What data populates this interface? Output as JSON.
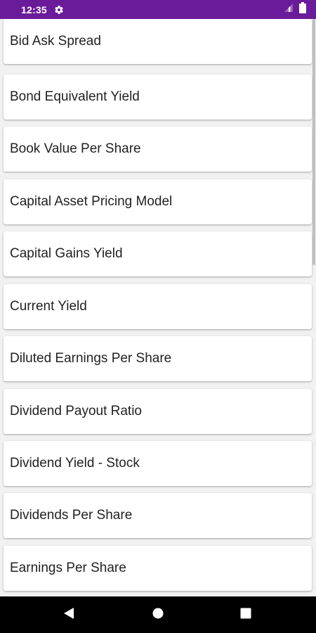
{
  "status_bar": {
    "time": "12:35",
    "icons": [
      "gear-icon",
      "signal-icon",
      "battery-icon"
    ],
    "background": "#6a1b9a"
  },
  "list": {
    "items": [
      {
        "label": "Bid Ask Spread"
      },
      {
        "label": "Bond Equivalent Yield"
      },
      {
        "label": "Book Value Per Share"
      },
      {
        "label": "Capital Asset Pricing Model"
      },
      {
        "label": "Capital Gains Yield"
      },
      {
        "label": "Current Yield"
      },
      {
        "label": "Diluted Earnings Per Share"
      },
      {
        "label": "Dividend Payout Ratio"
      },
      {
        "label": "Dividend Yield - Stock"
      },
      {
        "label": "Dividends Per Share"
      },
      {
        "label": "Earnings Per Share"
      }
    ]
  },
  "nav_bar": {
    "buttons": [
      "back-icon",
      "home-icon",
      "recents-icon"
    ]
  }
}
